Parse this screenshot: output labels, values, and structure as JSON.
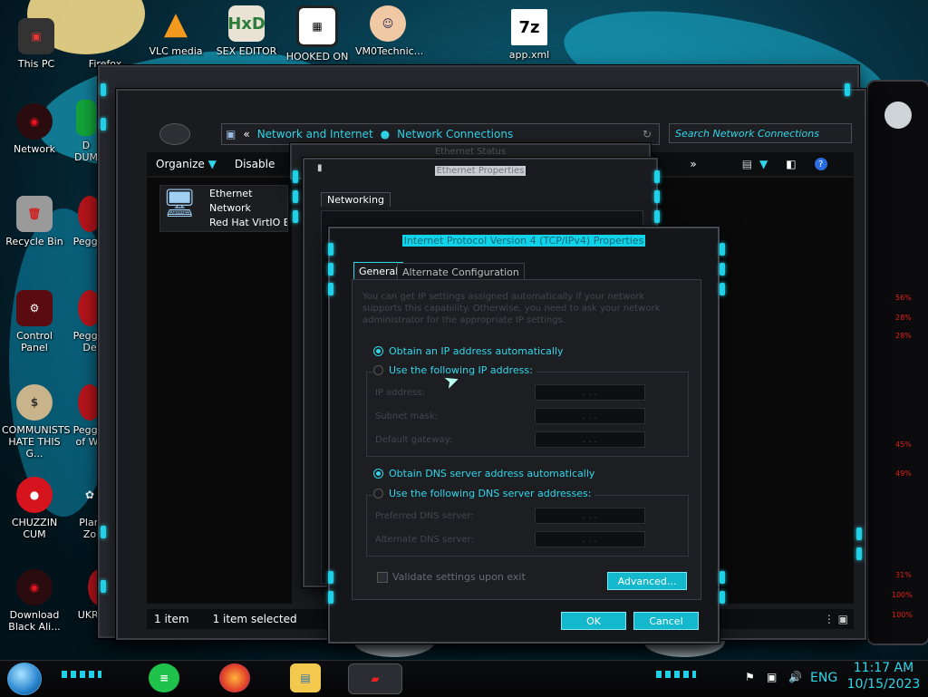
{
  "desktop": {
    "top_icons": [
      {
        "label": "This PC"
      },
      {
        "label": "Firefox"
      },
      {
        "label": "VLC media"
      },
      {
        "label": "SEX EDITOR"
      },
      {
        "label": "HOOKED ON"
      },
      {
        "label": "VM0Technic..."
      },
      {
        "label": "app.xml"
      }
    ],
    "left_icons": [
      {
        "label": "Network"
      },
      {
        "label": "Recycle Bin"
      },
      {
        "label": "Control Panel"
      },
      {
        "label": "COMMUNISTS HATE THIS G..."
      },
      {
        "label": "CHUZZIN CUM"
      },
      {
        "label": "Download Black Ali..."
      }
    ],
    "second_col_icons": [
      {
        "label": "D\nDUM"
      },
      {
        "label": "Peggle"
      },
      {
        "label": "Peggle\nDe"
      },
      {
        "label": "Peggle\nof Wa"
      },
      {
        "label": "Plan\nZo"
      },
      {
        "label": "UKRAINE"
      }
    ],
    "side_gauges": [
      "56%",
      "28%",
      "28%",
      "45%",
      "49%",
      "31%",
      "100%",
      "100%"
    ]
  },
  "explorer": {
    "breadcrumb": [
      "Network and Internet",
      "Network Connections"
    ],
    "search_placeholder": "Search Network Connections",
    "toolbar": {
      "organize": "Organize",
      "disable": "Disable",
      "more": "»"
    },
    "item": {
      "name": "Ethernet",
      "network": "Network",
      "adapter": "Red Hat VirtIO E"
    },
    "status": {
      "count": "1 item",
      "selected": "1 item selected"
    }
  },
  "ethernet_status": {
    "title": "Ethernet Status"
  },
  "ethernet_props": {
    "title": "Ethernet Properties",
    "tab": "Networking"
  },
  "ipv4": {
    "title": "Internet Protocol Version 4 (TCP/IPv4) Properties",
    "tabs": [
      "General",
      "Alternate Configuration"
    ],
    "description": "You can get IP settings assigned automatically if your network supports this capability. Otherwise, you need to ask your network administrator for the appropriate IP settings.",
    "ip_auto": "Obtain an IP address automatically",
    "ip_manual": "Use the following IP address:",
    "ip_fields": [
      "IP address:",
      "Subnet mask:",
      "Default gateway:"
    ],
    "dns_auto": "Obtain DNS server address automatically",
    "dns_manual": "Use the following DNS server addresses:",
    "dns_fields": [
      "Preferred DNS server:",
      "Alternate DNS server:"
    ],
    "ip_placeholder": ". . .",
    "validate": "Validate settings upon exit",
    "advanced": "Advanced...",
    "ok": "OK",
    "cancel": "Cancel"
  },
  "taskbar": {
    "language": "ENG",
    "time": "11:17 AM",
    "date": "10/15/2023"
  },
  "colors": {
    "accent": "#2fd7ea",
    "button": "#14b8cc",
    "frame": "#1b1c20"
  }
}
